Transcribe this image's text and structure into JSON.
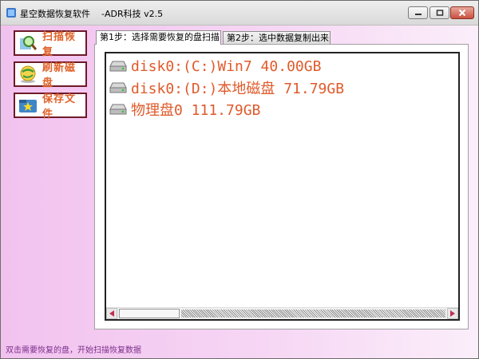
{
  "window": {
    "title": "星空数据恢复软件    -ADR科技 v2.5"
  },
  "sidebar": {
    "items": [
      {
        "label": "扫描恢复",
        "icon": "magnifier-icon"
      },
      {
        "label": "刷新磁盘",
        "icon": "globe-icon"
      },
      {
        "label": "保存文件",
        "icon": "save-folder-icon"
      }
    ]
  },
  "tabs": [
    {
      "label": "第1步：选择需要恢复的盘扫描",
      "active": true
    },
    {
      "label": "第2步：选中数据复制出来",
      "active": false
    }
  ],
  "disks": [
    {
      "label": "disk0:(C:)Win7 40.00GB"
    },
    {
      "label": "disk0:(D:)本地磁盘 71.79GB"
    },
    {
      "label": "物理盘0 111.79GB"
    }
  ],
  "status": {
    "text": "双击需要恢复的盘，开始扫描恢复数据"
  },
  "colors": {
    "accent_text": "#e05a2a",
    "sidebar_border": "#6e1a28",
    "status_text": "#7a2e8a",
    "background_left": "#f2c2ef",
    "background_right": "#fbeefa"
  }
}
